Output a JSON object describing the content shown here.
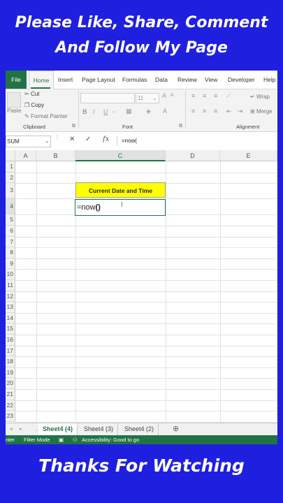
{
  "banner": {
    "top_line1": "Please Like, Share, Comment",
    "top_line2": "And Follow My Page",
    "bottom": "Thanks For Watching"
  },
  "ribbon_tabs": [
    "File",
    "Home",
    "Insert",
    "Page Layout",
    "Formulas",
    "Data",
    "Review",
    "View",
    "Developer",
    "Help"
  ],
  "clipboard": {
    "paste": "Paste",
    "cut": "Cut",
    "copy": "Copy",
    "format_painter": "Format Painter",
    "label": "Clipboard"
  },
  "font_group": {
    "size": "11",
    "bold": "B",
    "italic": "I",
    "underline": "U",
    "label": "Font"
  },
  "alignment_group": {
    "wrap": "Wrap",
    "merge": "Merge",
    "label": "Alignment"
  },
  "formula_bar": {
    "name_box": "SUM",
    "cancel": "✕",
    "enter": "✓",
    "fx": "fx",
    "formula": "=now("
  },
  "columns": [
    "A",
    "B",
    "C",
    "D",
    "E"
  ],
  "rows": [
    "1",
    "2",
    "3",
    "4",
    "5",
    "6",
    "7",
    "8",
    "9",
    "10",
    "11",
    "12",
    "13",
    "14",
    "15",
    "16",
    "17",
    "18",
    "19",
    "20",
    "21",
    "22",
    "23"
  ],
  "cells": {
    "title": "Current Date and Time",
    "edit_text": "=now",
    "edit_parens": "()"
  },
  "sheets": [
    "Sheet4 (4)",
    "Sheet4 (3)",
    "Sheet4 (2)"
  ],
  "status": {
    "mode": "nter",
    "filter": "Filter Mode",
    "accessibility": "Accessibility: Good to go"
  },
  "colors": {
    "excel_green": "#217346",
    "banner_blue": "#1f1fe0",
    "highlight_yellow": "#ffff00"
  }
}
